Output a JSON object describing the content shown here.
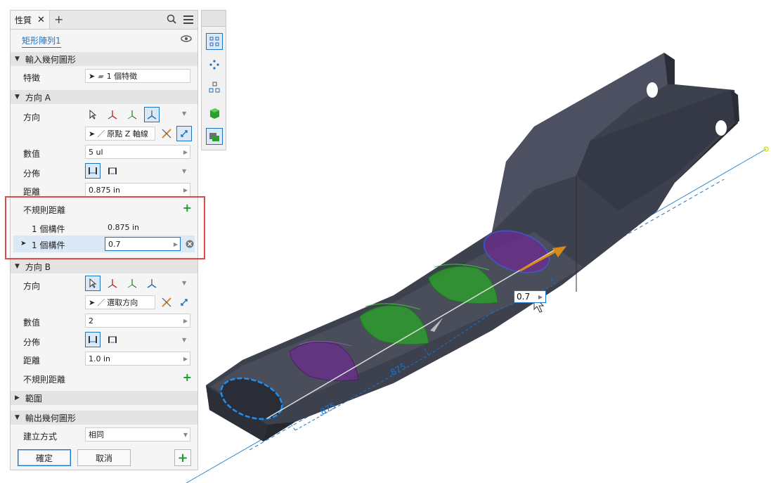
{
  "tabs": {
    "active_label": "性質",
    "close": "✕",
    "add": "+"
  },
  "feature": {
    "name": "矩形陣列1"
  },
  "sections": {
    "input_geometry": "輸入幾何圖形",
    "direction_a": "方向 A",
    "direction_b": "方向 B",
    "range": "範圍",
    "output_geometry": "輸出幾何圖形"
  },
  "input": {
    "feature_label": "特徵",
    "feature_value": "1 個特徵"
  },
  "dir_a": {
    "direction_label": "方向",
    "axis_value": "原點 Z 軸線",
    "count_label": "數值",
    "count_value": "5 ul",
    "distribution_label": "分佈",
    "distance_label": "距離",
    "distance_value": "0.875 in",
    "irregular_label": "不規則距離",
    "irr_rows": [
      {
        "label": "1 個構件",
        "value": "0.875 in"
      },
      {
        "label": "1 個構件",
        "value": "0.7"
      }
    ]
  },
  "dir_b": {
    "direction_label": "方向",
    "axis_value": "選取方向",
    "count_label": "數值",
    "count_value": "2",
    "distribution_label": "分佈",
    "distance_label": "距離",
    "distance_value": "1.0 in",
    "irregular_label": "不規則距離"
  },
  "output": {
    "create_label": "建立方式",
    "create_value": "相同"
  },
  "buttons": {
    "ok": "確定",
    "cancel": "取消"
  },
  "viewport": {
    "dim_input": "0.7",
    "dim1": ".875",
    "dim2": ".875"
  },
  "colors": {
    "accent": "#1b73c8",
    "highlight": "#e04a4a",
    "green": "#1a9c2a",
    "part": "#3d414d",
    "occ_green": "#2aa02a",
    "occ_purple": "#6a2d8c"
  }
}
